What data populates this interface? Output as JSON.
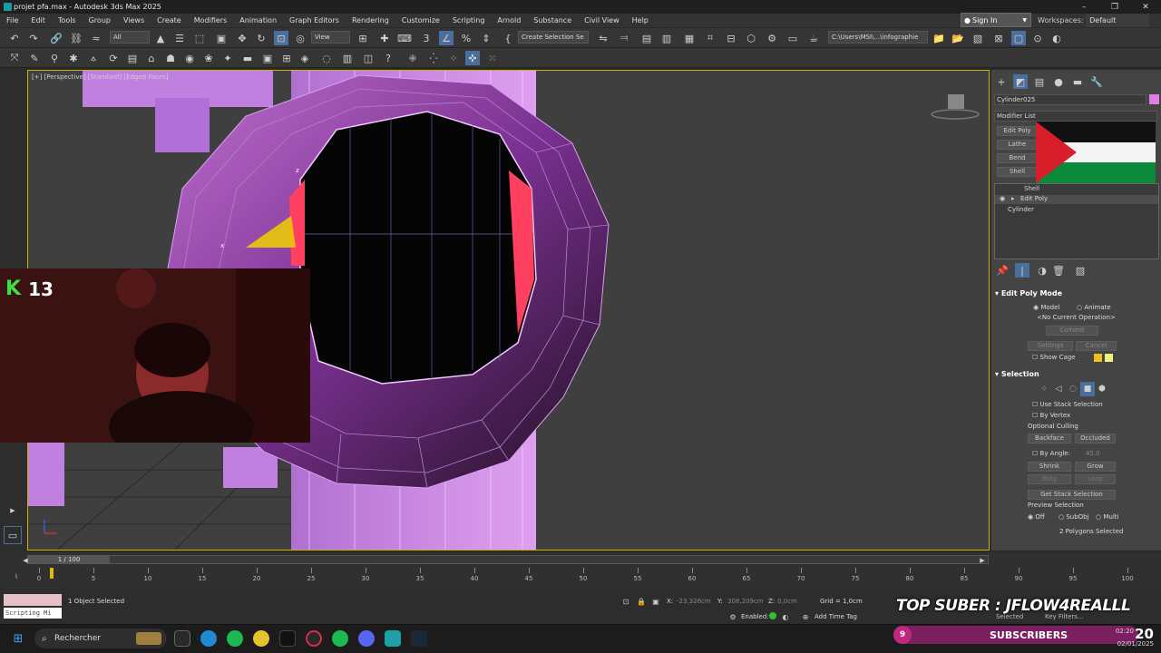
{
  "window": {
    "title": "projet pfa.max - Autodesk 3ds Max 2025",
    "controls": [
      "–",
      "❐",
      "✕"
    ]
  },
  "menu": [
    "File",
    "Edit",
    "Tools",
    "Group",
    "Views",
    "Create",
    "Modifiers",
    "Animation",
    "Graph Editors",
    "Rendering",
    "Customize",
    "Scripting",
    "Arnold",
    "Substance",
    "Civil View",
    "Help"
  ],
  "account": {
    "sign_in": "Sign In",
    "workspaces_label": "Workspaces:",
    "workspace": "Default"
  },
  "toolbar": {
    "filter": "All",
    "ref_coord": "View",
    "selection_set": "Create Selection Se",
    "project_path": "C:\\Users\\MSI\\...\\infographie"
  },
  "viewport": {
    "label": "[+] [Perspective] [Standard] [Edged Faces]"
  },
  "webcam": {
    "k_badge": "K",
    "k_count": "13"
  },
  "command_panel": {
    "object_name": "Cylinder025",
    "object_color": "#e080e0",
    "modifier_list": "Modifier List",
    "quick_buttons": [
      "Edit Poly",
      "Lathe",
      "Bend",
      "Shell"
    ],
    "stack": [
      "Shell",
      "Edit Poly",
      "Cylinder"
    ],
    "edit_poly_mode": {
      "title": "Edit Poly Mode",
      "model": "Model",
      "animate": "Animate",
      "current_op": "<No Current Operation>",
      "commit": "Commit",
      "settings": "Settings",
      "cancel": "Cancel",
      "show_cage": "Show Cage"
    },
    "selection": {
      "title": "Selection",
      "use_stack": "Use Stack Selection",
      "by_vertex": "By Vertex",
      "optional_culling": "Optional Culling",
      "backface": "Backface",
      "occluded": "Occluded",
      "by_angle": "By Angle:",
      "angle_value": "45.0",
      "shrink": "Shrink",
      "grow": "Grow",
      "ring": "Ring",
      "loop": "Loop",
      "get_stack": "Get Stack Selection",
      "preview_selection": "Preview Selection",
      "off": "Off",
      "subobj": "SubObj",
      "multi": "Multi",
      "status": "2 Polygons Selected"
    }
  },
  "timeline": {
    "slider": "1 / 100",
    "ticks": [
      "0",
      "5",
      "10",
      "15",
      "20",
      "25",
      "30",
      "35",
      "40",
      "45",
      "50",
      "55",
      "60",
      "65",
      "70",
      "75",
      "80",
      "85",
      "90",
      "95",
      "100"
    ]
  },
  "status": {
    "script_label": "Scripting Mi",
    "selection": "1 Object Selected",
    "x_label": "X:",
    "x_value": "-23,326cm",
    "y_label": "Y:",
    "y_value": "308,209cm",
    "z_label": "Z:",
    "z_value": "0,0cm",
    "grid": "Grid = 1,0cm",
    "enabled": "Enabled:",
    "time_tag": "Add Time Tag",
    "selected": "Selected",
    "key_filters": "Key Filters..."
  },
  "taskbar": {
    "search": "Rechercher",
    "time": "02:20",
    "date": "02/01/2025"
  },
  "overlay": {
    "top_suber": "TOP SUBER : JFLOW4REALLL",
    "subs_count": "9",
    "subscribers": "SUBSCRIBERS",
    "big_num": "20"
  }
}
